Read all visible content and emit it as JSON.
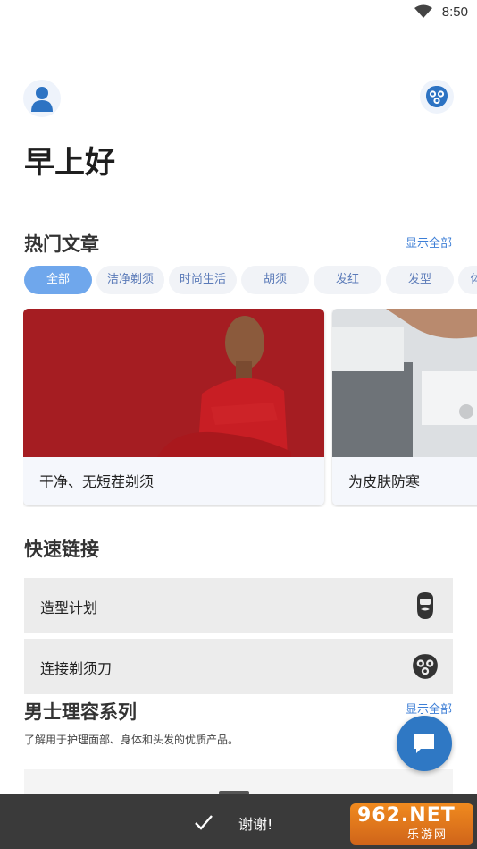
{
  "status_bar": {
    "time": "8:50",
    "wifi_icon": "wifi-icon"
  },
  "header": {
    "profile_icon": "user-icon",
    "device_icon": "shaver-head-icon"
  },
  "greeting": "早上好",
  "popular": {
    "title": "热门文章",
    "show_all": "显示全部",
    "chips": [
      "全部",
      "洁净剃须",
      "时尚生活",
      "胡须",
      "发红",
      "发型",
      "体"
    ],
    "active_chip": "全部",
    "articles": [
      {
        "caption": "干净、无短茬剃须"
      },
      {
        "caption": "为皮肤防寒"
      }
    ]
  },
  "quick_links": {
    "title": "快速链接",
    "items": [
      {
        "label": "造型计划",
        "icon": "beard-face-icon"
      },
      {
        "label": "连接剃须刀",
        "icon": "shaver-head-icon"
      }
    ]
  },
  "series": {
    "title": "男士理容系列",
    "show_all": "显示全部",
    "subtitle": "了解用于护理面部、身体和头发的优质产品。"
  },
  "fab": {
    "icon": "chat-icon"
  },
  "toast": {
    "message": "谢谢!",
    "icon": "check-icon"
  },
  "watermark": {
    "brand": "962.NET",
    "sub": "乐游网"
  },
  "colors": {
    "accent": "#3c7ed6",
    "chip_active": "#6fa7ec",
    "fab": "#2f78c4",
    "toast_bg": "#3a3a3a"
  }
}
